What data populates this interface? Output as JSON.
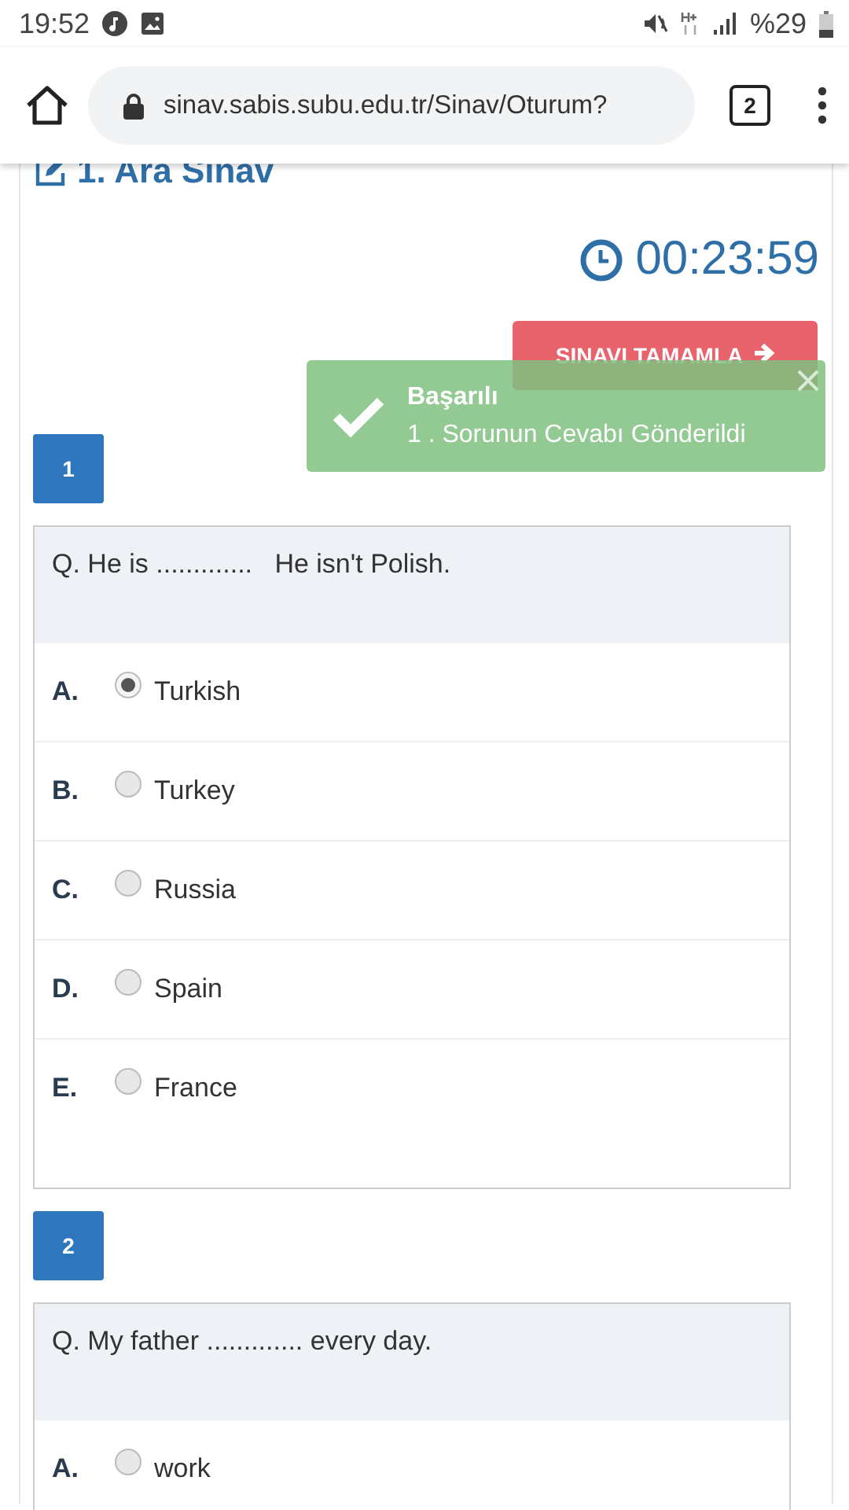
{
  "status_bar": {
    "time": "19:52",
    "battery": "%29"
  },
  "browser": {
    "url": "sinav.sabis.subu.edu.tr/Sinav/Oturum?",
    "tab_count": "2"
  },
  "exam_title": "1. Ara Sınav",
  "timer": "00:23:59",
  "finish_button": "SINAVI TAMAMLA",
  "toast": {
    "title": "Başarılı",
    "message": "1 . Sorunun Cevabı Gönderildi"
  },
  "questions": [
    {
      "number": "1",
      "text": "Q. He is .............   He isn't Polish.",
      "options": [
        {
          "letter": "A.",
          "text": "Turkish",
          "selected": true
        },
        {
          "letter": "B.",
          "text": "Turkey",
          "selected": false
        },
        {
          "letter": "C.",
          "text": "Russia",
          "selected": false
        },
        {
          "letter": "D.",
          "text": "Spain",
          "selected": false
        },
        {
          "letter": "E.",
          "text": "France",
          "selected": false
        }
      ]
    },
    {
      "number": "2",
      "text": "Q. My father ............. every day.",
      "options": [
        {
          "letter": "A.",
          "text": "work",
          "selected": false
        }
      ]
    }
  ]
}
